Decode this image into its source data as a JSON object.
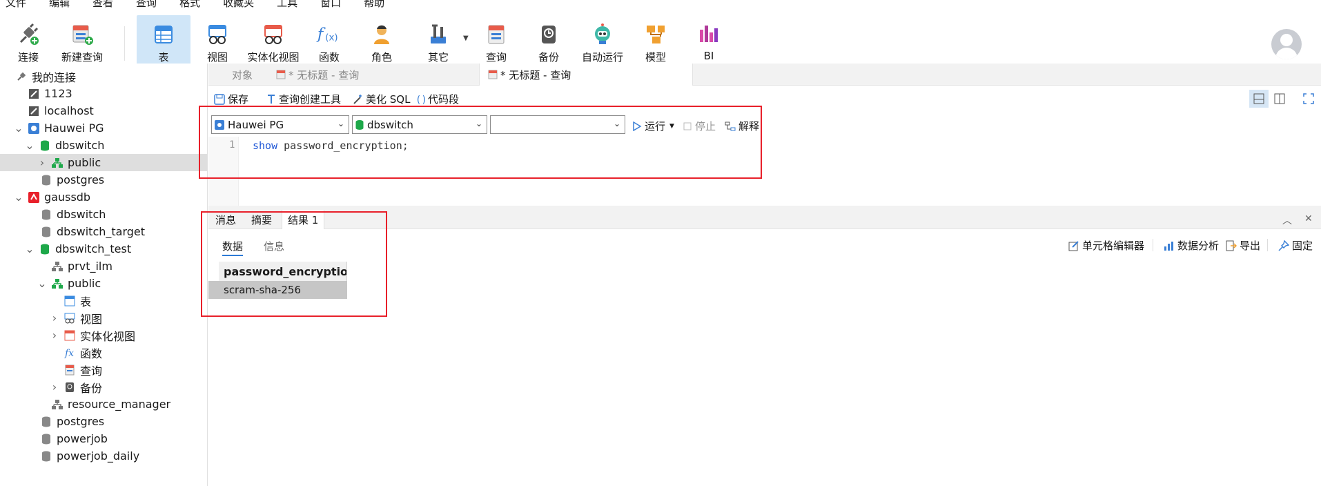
{
  "menu": [
    "文件",
    "编辑",
    "查看",
    "查询",
    "格式",
    "收藏夹",
    "工具",
    "窗口",
    "帮助"
  ],
  "toolbar": {
    "connect": "连接",
    "new_query": "新建查询",
    "table": "表",
    "view": "视图",
    "materialized_view": "实体化视图",
    "function": "函数",
    "role": "角色",
    "other": "其它",
    "query": "查询",
    "backup": "备份",
    "automation": "自动运行",
    "model": "模型",
    "bi": "BI"
  },
  "sidebar": {
    "root": "我的连接",
    "items": [
      {
        "label": "1123"
      },
      {
        "label": "localhost"
      },
      {
        "label": "Hauwei PG"
      },
      {
        "label": "dbswitch"
      },
      {
        "label": "public"
      },
      {
        "label": "postgres"
      },
      {
        "label": "gaussdb"
      },
      {
        "label": "dbswitch"
      },
      {
        "label": "dbswitch_target"
      },
      {
        "label": "dbswitch_test"
      },
      {
        "label": "prvt_ilm"
      },
      {
        "label": "public"
      },
      {
        "label": "表"
      },
      {
        "label": "视图"
      },
      {
        "label": "实体化视图"
      },
      {
        "label": "函数"
      },
      {
        "label": "查询"
      },
      {
        "label": "备份"
      },
      {
        "label": "resource_manager"
      },
      {
        "label": "postgres"
      },
      {
        "label": "powerjob"
      },
      {
        "label": "powerjob_daily"
      }
    ]
  },
  "tabs": {
    "objects": "对象",
    "tab1": "* 无标题 - 查询",
    "tab2": "* 无标题 - 查询"
  },
  "editor_toolbar": {
    "save": "保存",
    "query_builder": "查询创建工具",
    "beautify": "美化 SQL",
    "snippet": "代码段"
  },
  "selectors": {
    "connection": "Hauwei PG",
    "database": "dbswitch",
    "schema": "",
    "run": "运行",
    "stop": "停止",
    "explain": "解释"
  },
  "editor": {
    "line_number": "1",
    "keyword": "show",
    "rest": " password_encryption;"
  },
  "result_tabs": {
    "messages": "消息",
    "summary": "摘要",
    "result1": "结果 1"
  },
  "result_subtabs": {
    "data": "数据",
    "info": "信息"
  },
  "result_tools": {
    "cell_editor": "单元格编辑器",
    "data_analysis": "数据分析",
    "export": "导出",
    "pin": "固定"
  },
  "grid": {
    "columns": [
      "password_encryption"
    ],
    "rows": [
      [
        "scram-sha-256"
      ]
    ]
  },
  "colors": {
    "annotation_red": "#e8202a",
    "active_tool_bg": "#d0e6f8",
    "keyword_blue": "#1f57d6"
  }
}
